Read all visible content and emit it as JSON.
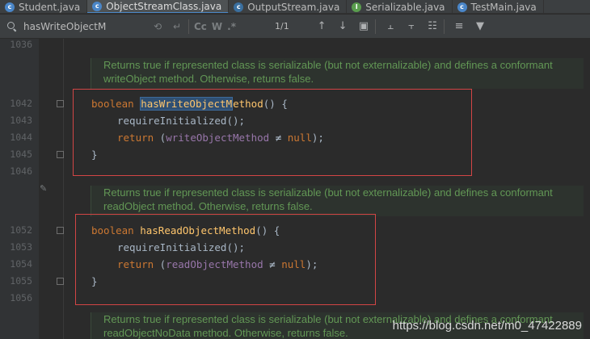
{
  "tabs": [
    {
      "label": "Student.java",
      "icon": "c",
      "active": false
    },
    {
      "label": "ObjectStreamClass.java",
      "icon": "c",
      "active": true
    },
    {
      "label": "OutputStream.java",
      "icon": "c",
      "active": false
    },
    {
      "label": "Serializable.java",
      "icon": "i",
      "active": false
    },
    {
      "label": "TestMain.java",
      "icon": "c",
      "active": false
    }
  ],
  "search": {
    "query": "hasWriteObjectM",
    "case_option": "Cc",
    "words_option": "W",
    "regex_option": ".*",
    "match_count": "1/1"
  },
  "gutter": {
    "line_1036": "1036",
    "line_1042": "1042",
    "line_1043": "1043",
    "line_1044": "1044",
    "line_1045": "1045",
    "line_1046": "1046",
    "line_1052": "1052",
    "line_1053": "1053",
    "line_1054": "1054",
    "line_1055": "1055",
    "line_1056": "1056"
  },
  "docs": {
    "doc1": "Returns true if represented class is serializable (but not externalizable) and defines a conformant writeObject method. Otherwise, returns false.",
    "doc2": "Returns true if represented class is serializable (but not externalizable) and defines a conformant readObject method. Otherwise, returns false.",
    "doc3": "Returns true if represented class is serializable (but not externalizable) and defines a conformant readObjectNoData method. Otherwise, returns false."
  },
  "code": {
    "kw_boolean": "boolean",
    "kw_return": "return",
    "null": "null",
    "neq": "≠",
    "method1_highlight": "hasWriteObjectM",
    "method1_rest": "ethod",
    "method2": "hasReadObjectMethod",
    "require_call": "requireInitialized",
    "field1": "writeObjectMethod",
    "field2": "readObjectMethod",
    "parens": "()",
    "brace_open": " {",
    "brace_close": "}",
    "call_tail": "();",
    "return_open": " (",
    "return_close": ");"
  },
  "watermark": "https://blog.csdn.net/m0_47422889",
  "colors": {
    "background": "#2b2b2b",
    "keyword": "#cc7832",
    "method": "#ffc66d",
    "field": "#9876aa",
    "doc_comment": "#629755",
    "annotation_box": "#d24545"
  }
}
